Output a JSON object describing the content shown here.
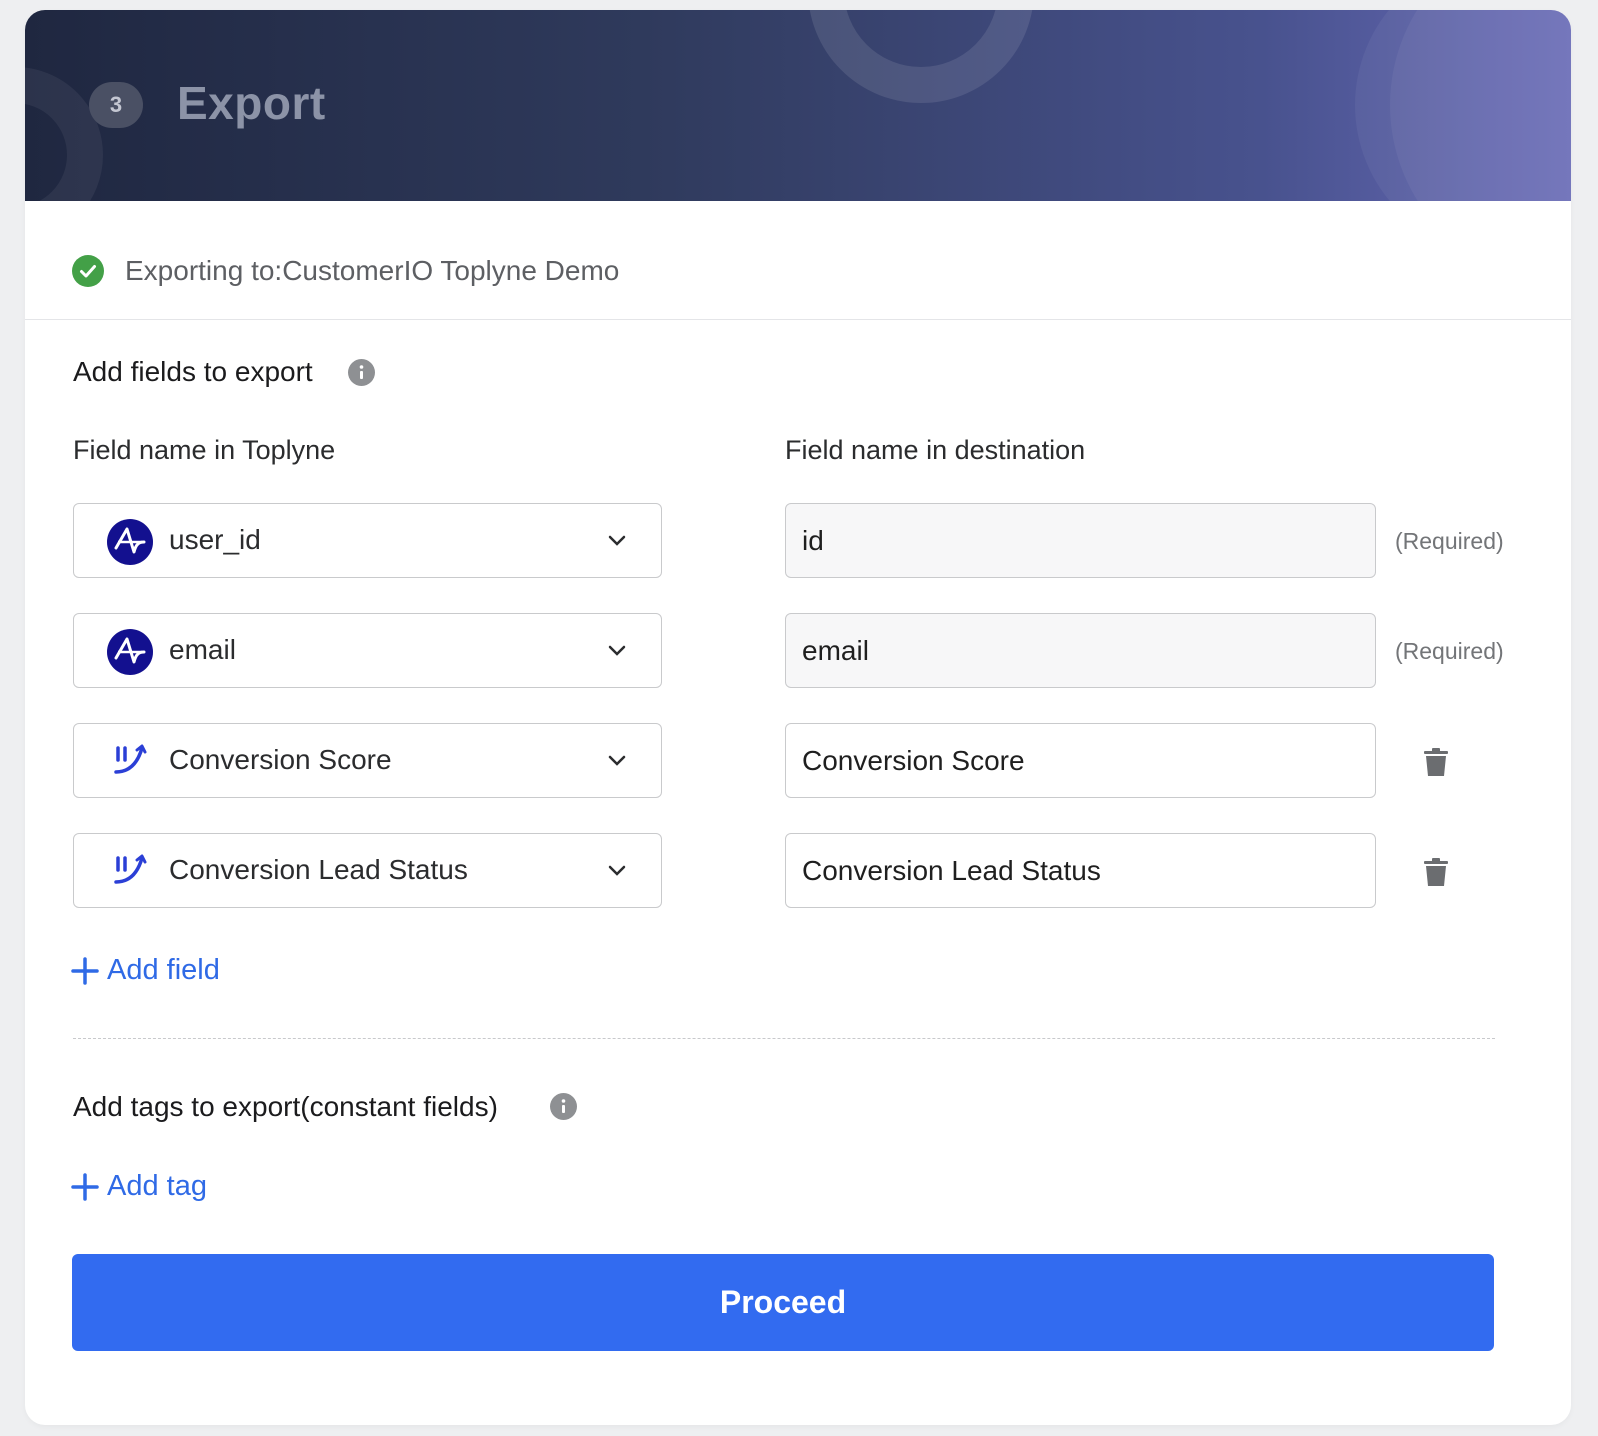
{
  "header": {
    "step_number": "3",
    "title": "Export",
    "gradient_colors": [
      "#1f2740",
      "#6769b6"
    ]
  },
  "status": {
    "icon": "check-circle-icon",
    "color": "#43a047",
    "text": "Exporting to:CustomerIO Toplyne Demo"
  },
  "fields_section": {
    "title": "Add fields to export",
    "info_icon": "info-icon",
    "col_source": "Field name in Toplyne",
    "col_destination": "Field name in destination",
    "rows": [
      {
        "source_icon": "amplitude-icon",
        "source": "user_id",
        "destination": "id",
        "suffix": "(Required)"
      },
      {
        "source_icon": "amplitude-icon",
        "source": "email",
        "destination": "email",
        "suffix": "(Required)"
      },
      {
        "source_icon": "toplyne-icon",
        "source": "Conversion Score",
        "destination": "Conversion Score",
        "suffix": "trash-icon"
      },
      {
        "source_icon": "toplyne-icon",
        "source": "Conversion Lead Status",
        "destination": "Conversion Lead Status",
        "suffix": "trash-icon"
      }
    ],
    "add_label": "Add field"
  },
  "tags_section": {
    "title": "Add tags to export(constant fields)",
    "info_icon": "info-icon",
    "add_label": "Add tag"
  },
  "proceed_label": "Proceed",
  "accent_color": "#326bf0"
}
